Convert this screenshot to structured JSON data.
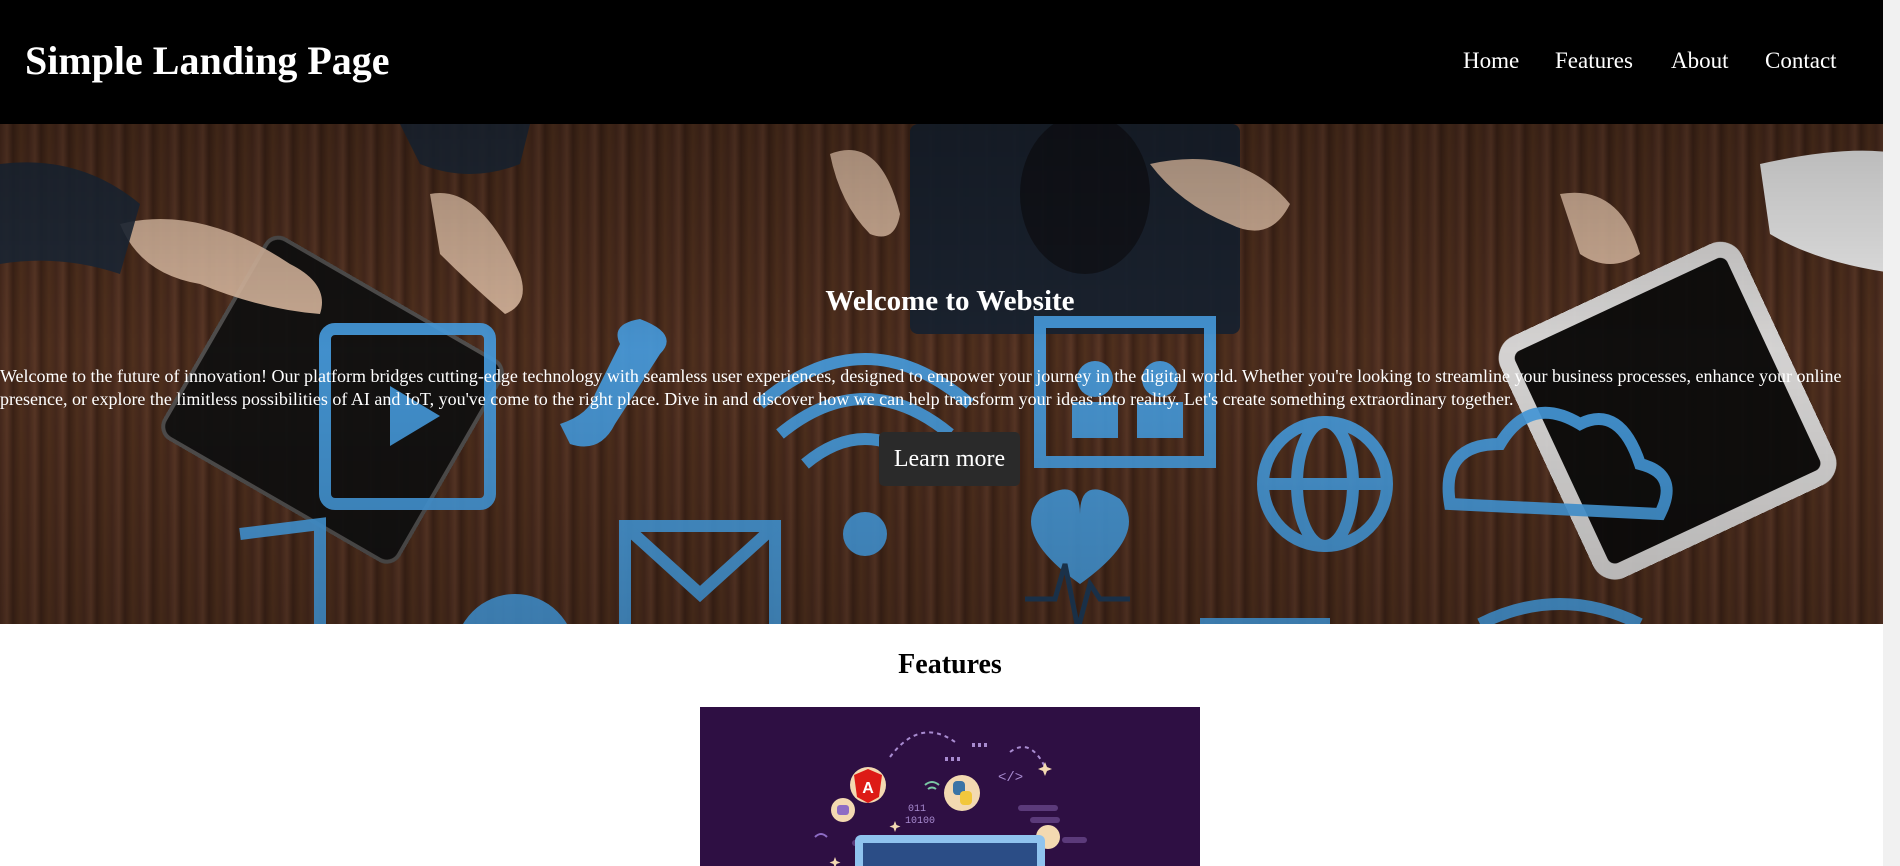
{
  "header": {
    "title": "Simple Landing Page",
    "nav": [
      "Home",
      "Features",
      "About",
      "Contact"
    ]
  },
  "hero": {
    "title": "Welcome to Website",
    "text": "Welcome to the future of innovation! Our platform bridges cutting-edge technology with seamless user experiences, designed to empower your journey in the digital world. Whether you're looking to streamline your business processes, enhance your online presence, or explore the limitless possibilities of AI and IoT, you've come to the right place. Dive in and discover how we can help transform your ideas into reality. Let's create something extraordinary together.",
    "button_label": "Learn more"
  },
  "features": {
    "title": "Features"
  },
  "colors": {
    "header_bg": "#000000",
    "icon_blue": "#4aa3e8",
    "feature_bg": "#2e0f43"
  }
}
